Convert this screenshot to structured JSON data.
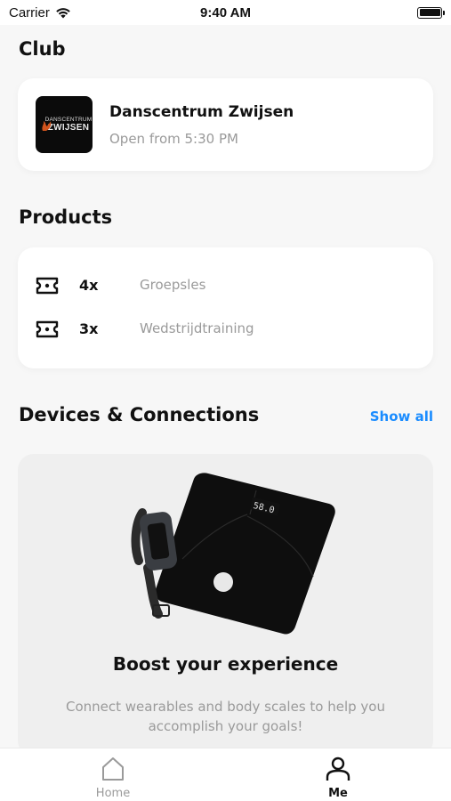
{
  "status_bar": {
    "carrier": "Carrier",
    "time": "9:40 AM"
  },
  "club": {
    "heading": "Club",
    "logo_line1": "DANSCENTRUM",
    "logo_line2": "ZWIJSEN",
    "name": "Danscentrum Zwijsen",
    "status": "Open from 5:30 PM"
  },
  "products": {
    "heading": "Products",
    "items": [
      {
        "qty": "4x",
        "name": "Groepsles",
        "icon": "ticket-icon"
      },
      {
        "qty": "3x",
        "name": "Wedstrijdtraining",
        "icon": "ticket-icon"
      }
    ]
  },
  "devices": {
    "heading": "Devices & Connections",
    "show_all_label": "Show all",
    "scale_display": "58.0",
    "promo_title": "Boost your experience",
    "promo_description": "Connect wearables and body scales to help you accomplish your goals!"
  },
  "tab_bar": {
    "tabs": [
      {
        "label": "Home",
        "icon": "home-icon",
        "active": false
      },
      {
        "label": "Me",
        "icon": "person-icon",
        "active": true
      }
    ]
  },
  "colors": {
    "accent": "#1a8cff",
    "muted_text": "#9a9a9a",
    "card_bg": "#ffffff",
    "promo_bg": "#efefef"
  }
}
